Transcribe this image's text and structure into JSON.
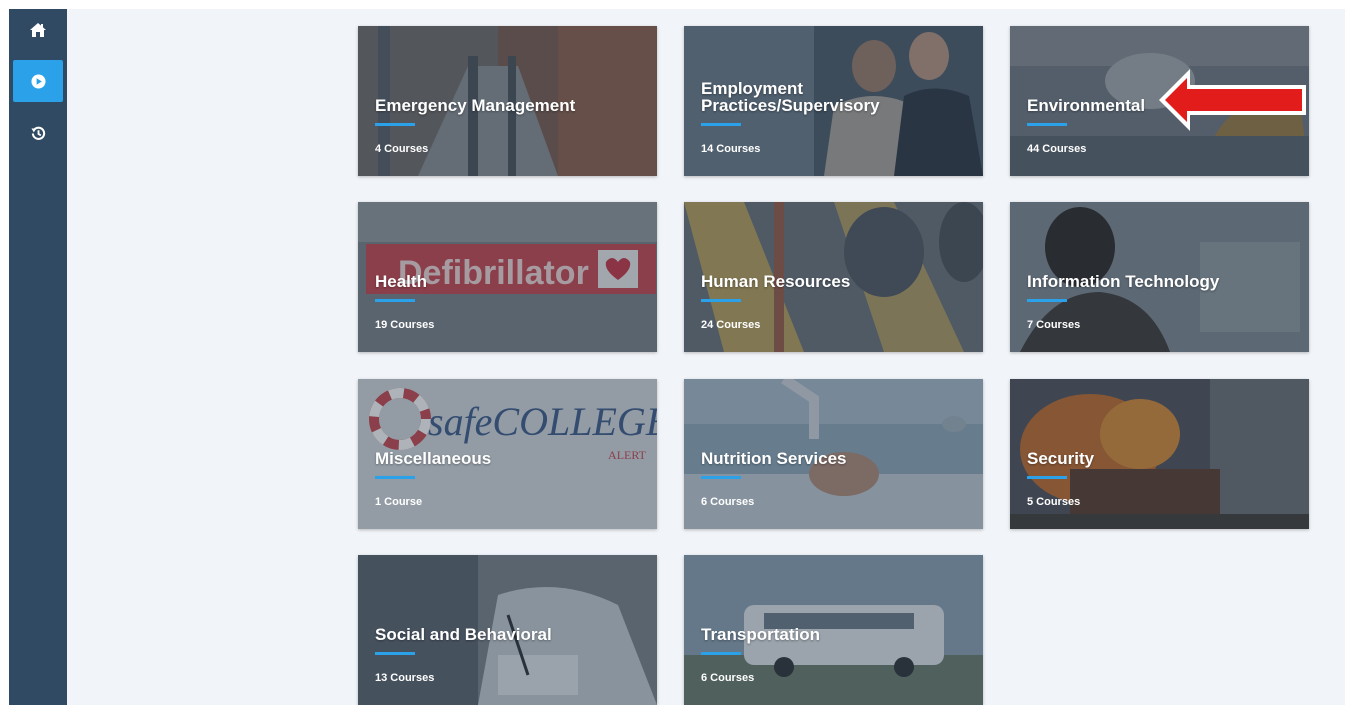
{
  "sidebar": {
    "items": [
      {
        "icon": "home-icon",
        "active": false
      },
      {
        "icon": "play-circle-icon",
        "active": true
      },
      {
        "icon": "history-icon",
        "active": false
      }
    ],
    "accent_color": "#2aa1e8",
    "background_color": "#2f4a62"
  },
  "categories": [
    {
      "title": "Emergency Management",
      "count": "4 Courses"
    },
    {
      "title": "Employment Practices/Supervisory",
      "count": "14 Courses"
    },
    {
      "title": "Environmental",
      "count": "44 Courses"
    },
    {
      "title": "Health",
      "count": "19 Courses"
    },
    {
      "title": "Human Resources",
      "count": "24 Courses"
    },
    {
      "title": "Information Technology",
      "count": "7 Courses"
    },
    {
      "title": "Miscellaneous",
      "count": "1 Course"
    },
    {
      "title": "Nutrition Services",
      "count": "6 Courses"
    },
    {
      "title": "Security",
      "count": "5 Courses"
    },
    {
      "title": "Social and Behavioral",
      "count": "13 Courses"
    },
    {
      "title": "Transportation",
      "count": "6 Courses"
    }
  ],
  "tile_images": {
    "health_sign": "Defibrillator",
    "misc_logo_main": "safeCOLLEGES",
    "misc_logo_sub": "ALERT"
  },
  "annotation": {
    "type": "red-arrow",
    "points_to": "Environmental"
  }
}
